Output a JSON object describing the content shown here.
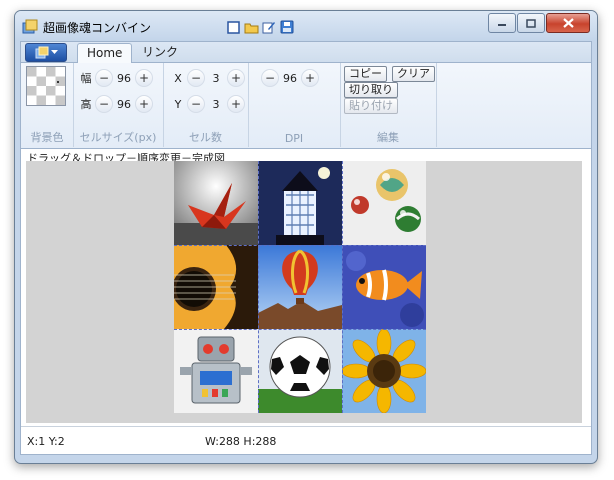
{
  "window": {
    "title": "超画像魂コンバイン"
  },
  "quick_access": [
    {
      "icon": "square-icon"
    },
    {
      "icon": "folder-icon"
    },
    {
      "icon": "edit-icon"
    },
    {
      "icon": "save-icon"
    }
  ],
  "tabs": [
    {
      "label": "Home",
      "active": true
    },
    {
      "label": "リンク",
      "active": false
    }
  ],
  "ribbon": {
    "bgcolor": {
      "label": "背景色"
    },
    "cellsize": {
      "label": "セルサイズ(px)",
      "width_label": "幅",
      "width_value": "96",
      "height_label": "高",
      "height_value": "96"
    },
    "cellcount": {
      "label": "セル数",
      "x_label": "X",
      "x_value": "3",
      "y_label": "Y",
      "y_value": "3"
    },
    "dpi": {
      "label": "DPI",
      "value": "96"
    },
    "edit": {
      "label": "編集",
      "copy": "コピー",
      "clear": "クリア",
      "cut": "切り取り",
      "paste": "貼り付け"
    },
    "minus": "−",
    "plus": "+"
  },
  "content": {
    "title": "ドラッグ＆ドロップ－順序変更－完成図",
    "tiles": [
      {
        "name": "origami-crane"
      },
      {
        "name": "lighthouse"
      },
      {
        "name": "marbles"
      },
      {
        "name": "guitar"
      },
      {
        "name": "hot-air-balloon"
      },
      {
        "name": "clownfish"
      },
      {
        "name": "robot-toy"
      },
      {
        "name": "soccer-ball"
      },
      {
        "name": "sunflower"
      }
    ]
  },
  "status": {
    "position": "X:1 Y:2",
    "size": "W:288 H:288"
  },
  "colors": {
    "accent": "#1d4fa3",
    "canvas": "#d3d3d3",
    "dash": "#5e6fc5"
  }
}
